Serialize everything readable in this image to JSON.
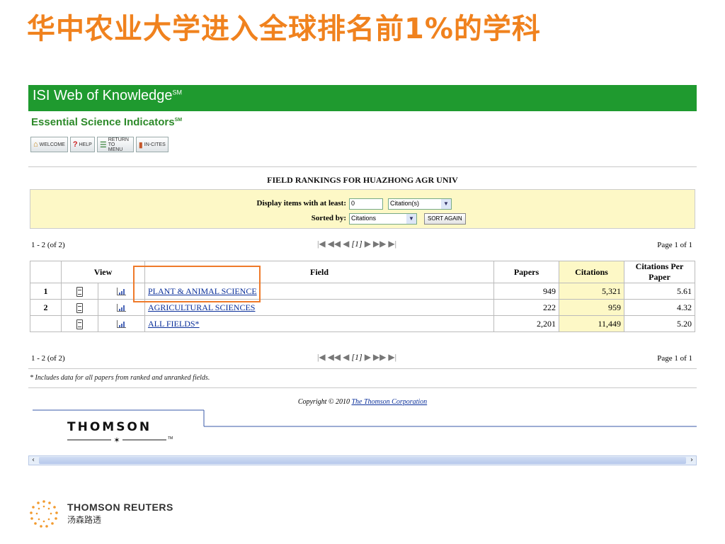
{
  "slide": {
    "title": "华中农业大学进入全球排名前1%的学科"
  },
  "app": {
    "banner_title": "ISI Web of Knowledge",
    "banner_mark": "SM",
    "sub_title": "Essential Science Indicators",
    "sub_mark": "SM",
    "toolbar": {
      "welcome": "WELCOME",
      "help": "HELP",
      "return_menu": "RETURN TO MENU",
      "in_cites": "IN-CITES"
    }
  },
  "rankings": {
    "heading": "FIELD RANKINGS FOR HUAZHONG AGR UNIV",
    "filter": {
      "display_label": "Display items with at least:",
      "threshold_value": "0",
      "unit_selected": "Citation(s)",
      "sorted_label": "Sorted by:",
      "sort_selected": "Citations",
      "sort_again_label": "SORT AGAIN"
    },
    "pager": {
      "range": "1 - 2 (of 2)",
      "current": "1",
      "page_info": "Page 1 of 1"
    },
    "columns": {
      "view": "View",
      "field": "Field",
      "papers": "Papers",
      "citations": "Citations",
      "citations_per_paper": "Citations Per Paper"
    },
    "rows": [
      {
        "rank": "1",
        "field": "PLANT & ANIMAL SCIENCE",
        "papers": "949",
        "citations": "5,321",
        "cpp": "5.61"
      },
      {
        "rank": "2",
        "field": "AGRICULTURAL SCIENCES",
        "papers": "222",
        "citations": "959",
        "cpp": "4.32"
      },
      {
        "rank": "",
        "field": "ALL FIELDS*",
        "papers": "2,201",
        "citations": "11,449",
        "cpp": "5.20"
      }
    ],
    "footnote": "* Includes data for all papers from ranked and unranked fields.",
    "copyright_prefix": "Copyright © 2010 ",
    "copyright_link": "The Thomson Corporation"
  },
  "logos": {
    "thomson": "THOMSON",
    "tm": "TM",
    "reuters_en": "THOMSON REUTERS",
    "reuters_cn": "汤森路透"
  },
  "colors": {
    "title_orange": "#f0821e",
    "banner_green": "#1f9a2f",
    "highlight_orange": "#ef7a2a",
    "filter_yellow": "#fdf8c6"
  }
}
